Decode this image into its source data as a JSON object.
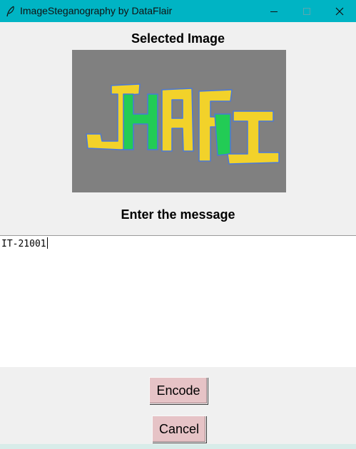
{
  "window": {
    "title": "ImageSteganography by DataFlair",
    "app_icon": "feather-icon",
    "controls": [
      "minimize-icon",
      "maximize-icon",
      "close-icon"
    ]
  },
  "labels": {
    "selected_image": "Selected Image",
    "enter_message": "Enter the message"
  },
  "image": {
    "description_icon": "image-preview",
    "lettering": "JHAFI",
    "colors": {
      "background": "#808080",
      "yellow": "#f2d22a",
      "green": "#22cc55",
      "outline": "#4a78d8"
    }
  },
  "message": {
    "value": "IT-21001"
  },
  "buttons": {
    "encode": "Encode",
    "cancel": "Cancel"
  },
  "colors": {
    "titlebar": "#00b4c4",
    "button_bg": "#e6c3c6",
    "window_bg": "#f0f0f0"
  }
}
